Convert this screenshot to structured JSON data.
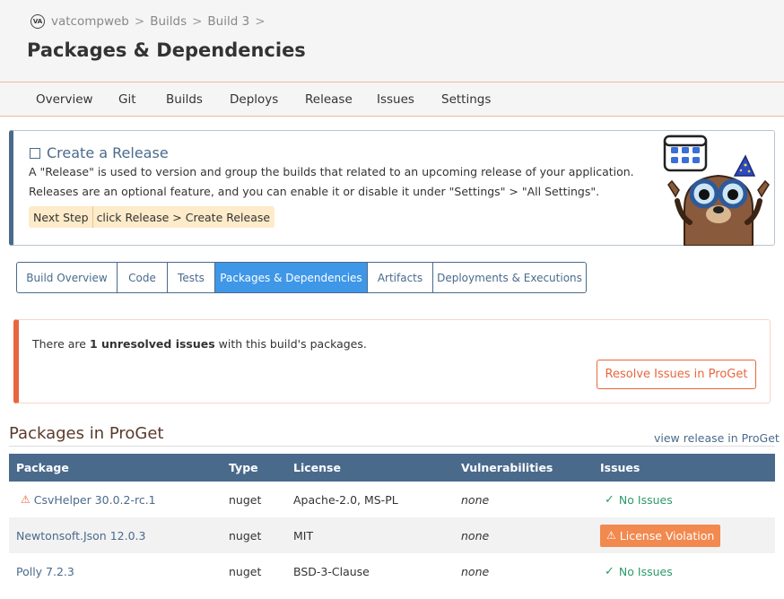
{
  "breadcrumb": {
    "logo_text": "VA",
    "project": "vatcompweb",
    "sep": ">",
    "builds": "Builds",
    "build": "Build 3"
  },
  "page_title": "Packages & Dependencies",
  "nav": [
    "Overview",
    "Git",
    "Builds",
    "Deploys",
    "Release",
    "Issues",
    "Settings"
  ],
  "release_banner": {
    "title": "Create a Release",
    "line1": "A \"Release\" is used to version and group the builds that related to an upcoming release of your application.",
    "line2": "Releases are an optional feature, and you can enable it or disable it under \"Settings\" > \"All Settings\".",
    "next_step_label": "Next Step",
    "next_step_value": "click Release > Create Release"
  },
  "tabs": [
    "Build Overview",
    "Code",
    "Tests",
    "Packages & Dependencies",
    "Artifacts",
    "Deployments & Executions"
  ],
  "issues_alert": {
    "text_before": "There are ",
    "count_text": "1 unresolved issues",
    "text_after": " with this build's packages.",
    "button": "Resolve Issues in ProGet"
  },
  "packages_section": {
    "title": "Packages in ProGet",
    "link": "view release in ProGet"
  },
  "table": {
    "headers": [
      "Package",
      "Type",
      "License",
      "Vulnerabilities",
      "Issues"
    ],
    "rows": [
      {
        "package": "CsvHelper 30.0.2-rc.1",
        "warning": true,
        "type": "nuget",
        "license": "Apache-2.0, MS-PL",
        "vulnerabilities": "none",
        "issues": "No Issues",
        "issue_status": "ok"
      },
      {
        "package": "Newtonsoft.Json 12.0.3",
        "warning": false,
        "type": "nuget",
        "license": "MIT",
        "vulnerabilities": "none",
        "issues": "License Violation",
        "issue_status": "violation"
      },
      {
        "package": "Polly 7.2.3",
        "warning": false,
        "type": "nuget",
        "license": "BSD-3-Clause",
        "vulnerabilities": "none",
        "issues": "No Issues",
        "issue_status": "ok"
      }
    ]
  },
  "colors": {
    "accent": "#4a6a8c",
    "active_tab": "#3f97e8",
    "warning": "#e8663d",
    "success": "#2e9a6a"
  }
}
